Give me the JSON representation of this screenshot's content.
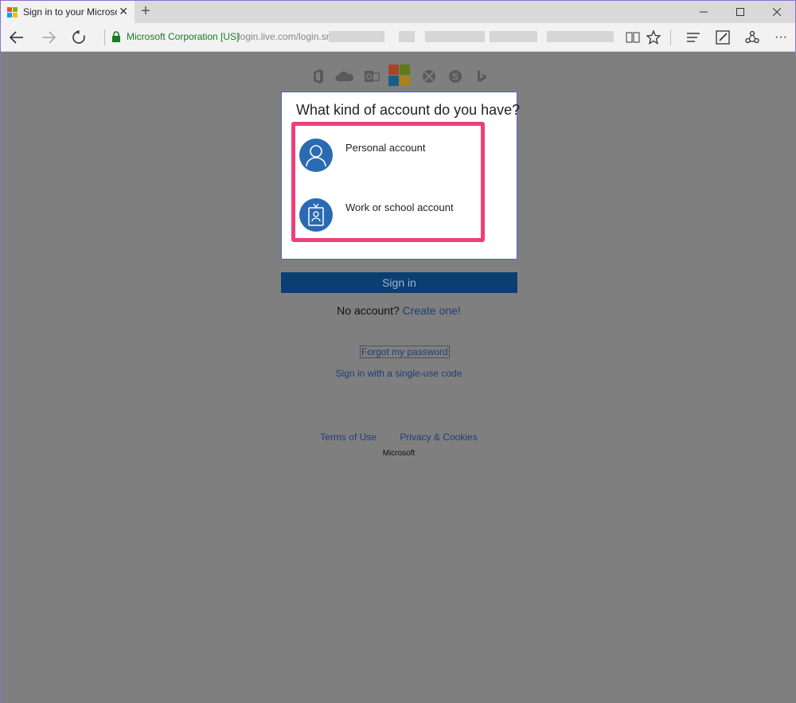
{
  "browser": {
    "tab_title": "Sign in to your Microsoft account",
    "new_tab_glyph": "+",
    "close_glyph": "✕",
    "minimize_glyph": "—",
    "maximize_glyph": "☐",
    "window_close_glyph": "✕",
    "address_org": "Microsoft Corporation [US]",
    "address_url": "login.live.com/login.srf?",
    "more_glyph": "···"
  },
  "page": {
    "card_title": "What kind of account do you have?",
    "accounts": [
      {
        "label": "Personal account",
        "icon": "person-icon"
      },
      {
        "label": "Work or school account",
        "icon": "badge-icon"
      }
    ],
    "signin_label": "Sign in",
    "no_account_text": "No account?",
    "create_link": "Create one!",
    "forgot_link": "Forgot my password",
    "single_use_link": "Sign in with a single-use code",
    "footer": {
      "terms": "Terms of Use",
      "privacy": "Privacy & Cookies",
      "brand": "Microsoft"
    }
  },
  "colors": {
    "accent_blue": "#2a6ab2",
    "highlight_pink": "#ef3f7a",
    "secure_green": "#1a7a25",
    "overlay_gray": "#7f7f7f"
  }
}
